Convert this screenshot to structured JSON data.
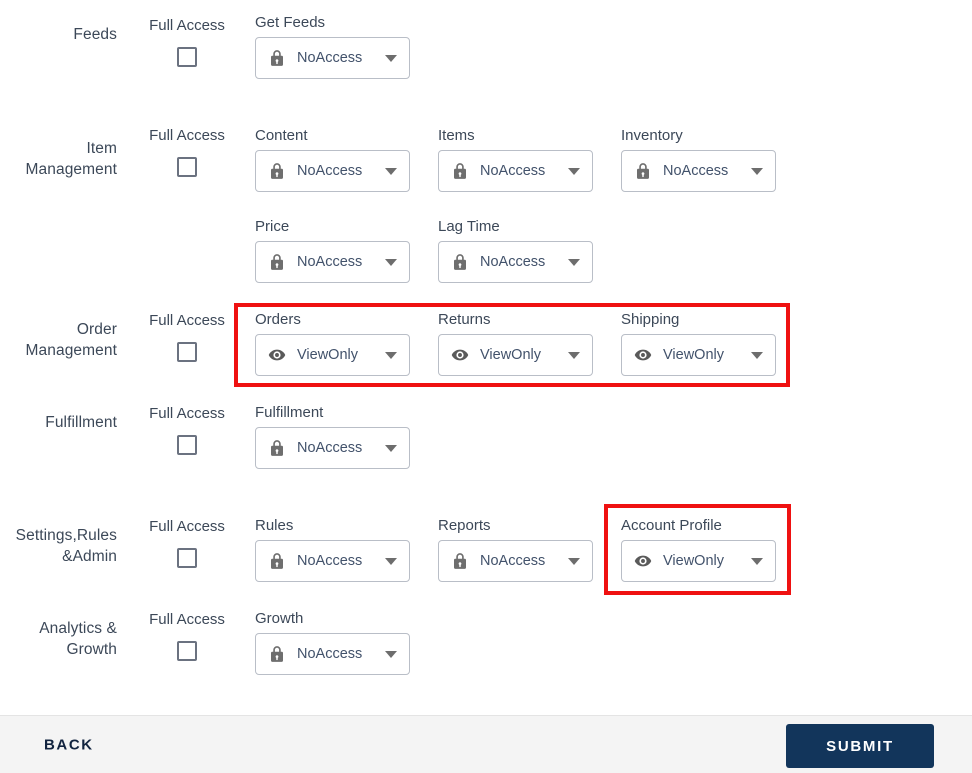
{
  "colors": {
    "accent_navy": "#12355b",
    "highlight_red": "#ef1111",
    "text": "#3c4858",
    "border": "#b9bec7",
    "footer_bg": "#f4f4f4"
  },
  "full_access_label": "Full Access",
  "rows": [
    {
      "category": "Feeds",
      "fields": [
        {
          "label": "Get Feeds",
          "value": "NoAccess",
          "icon": "lock-icon"
        }
      ]
    },
    {
      "category": "Item Management",
      "fields": [
        {
          "label": "Content",
          "value": "NoAccess",
          "icon": "lock-icon"
        },
        {
          "label": "Items",
          "value": "NoAccess",
          "icon": "lock-icon"
        },
        {
          "label": "Inventory",
          "value": "NoAccess",
          "icon": "lock-icon"
        },
        {
          "label": "Price",
          "value": "NoAccess",
          "icon": "lock-icon"
        },
        {
          "label": "Lag Time",
          "value": "NoAccess",
          "icon": "lock-icon"
        }
      ]
    },
    {
      "category": "Order Management",
      "highlighted": true,
      "fields": [
        {
          "label": "Orders",
          "value": "ViewOnly",
          "icon": "eye-icon"
        },
        {
          "label": "Returns",
          "value": "ViewOnly",
          "icon": "eye-icon"
        },
        {
          "label": "Shipping",
          "value": "ViewOnly",
          "icon": "eye-icon"
        }
      ]
    },
    {
      "category": "Fulfillment",
      "fields": [
        {
          "label": "Fulfillment",
          "value": "NoAccess",
          "icon": "lock-icon"
        }
      ]
    },
    {
      "category": "Settings,Rules &Admin",
      "fields": [
        {
          "label": "Rules",
          "value": "NoAccess",
          "icon": "lock-icon"
        },
        {
          "label": "Reports",
          "value": "NoAccess",
          "icon": "lock-icon"
        },
        {
          "label": "Account Profile",
          "value": "ViewOnly",
          "icon": "eye-icon",
          "highlighted": true
        }
      ]
    },
    {
      "category": "Analytics & Growth",
      "fields": [
        {
          "label": "Growth",
          "value": "NoAccess",
          "icon": "lock-icon"
        }
      ]
    }
  ],
  "footer": {
    "back_label": "BACK",
    "submit_label": "SUBMIT"
  }
}
